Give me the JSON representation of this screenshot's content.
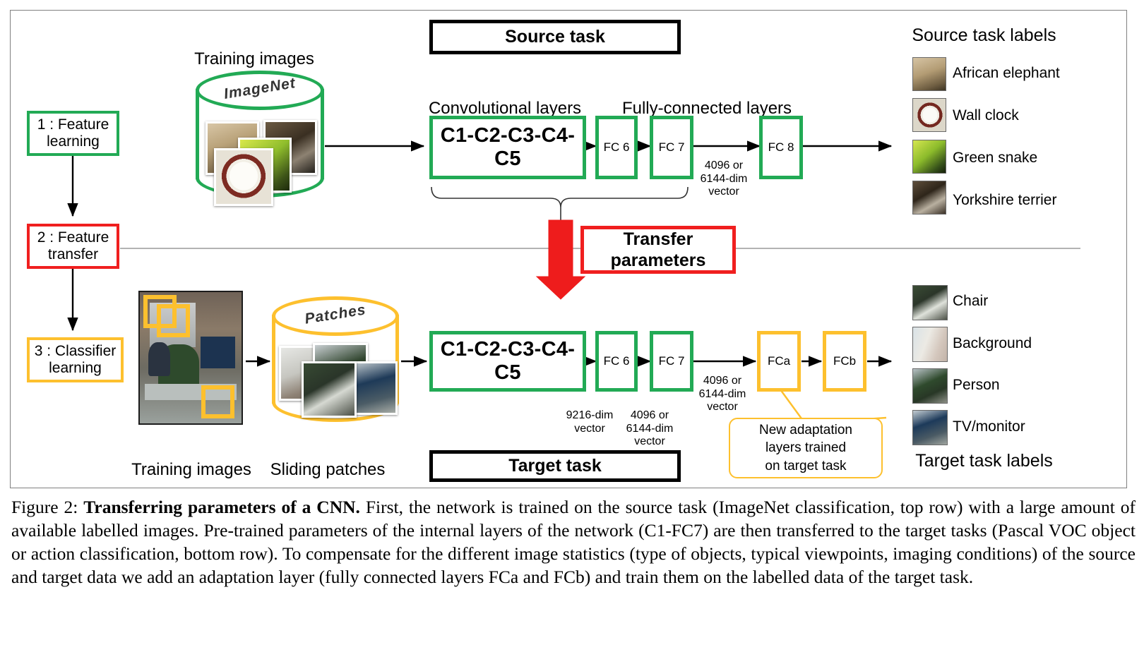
{
  "figure": {
    "banners": {
      "source_task": "Source task",
      "target_task": "Target task",
      "transfer_parameters": "Transfer\nparameters"
    },
    "stages": [
      {
        "label": "1 : Feature\nlearning",
        "color": "#22aa55"
      },
      {
        "label": "2 : Feature\ntransfer",
        "color": "#f01f1f"
      },
      {
        "label": "3 : Classifier\nlearning",
        "color": "#fdc02e"
      }
    ],
    "source_row": {
      "training_images_label": "Training images",
      "database_name": "ImageNet",
      "group_labels": {
        "conv": "Convolutional layers",
        "fc": "Fully-connected layers"
      },
      "layers": [
        {
          "name": "C1-C2-C3-C4-C5",
          "color": "#22aa55"
        },
        {
          "name": "FC 6",
          "color": "#22aa55"
        },
        {
          "name": "FC 7",
          "color": "#22aa55"
        },
        {
          "name": "FC 8",
          "color": "#22aa55"
        }
      ],
      "vector_label": "4096 or\n6144-dim\nvector"
    },
    "target_row": {
      "training_images_label": "Training images",
      "sliding_patches_label": "Sliding patches",
      "database_name": "Patches",
      "layers": [
        {
          "name": "C1-C2-C3-C4-C5",
          "color": "#22aa55"
        },
        {
          "name": "FC 6",
          "color": "#22aa55"
        },
        {
          "name": "FC 7",
          "color": "#22aa55"
        },
        {
          "name": "FCa",
          "color": "#fdc02e"
        },
        {
          "name": "FCb",
          "color": "#fdc02e"
        }
      ],
      "vector_labels": {
        "after_c5": "9216-dim\nvector",
        "after_fc6": "4096 or\n6144-dim\nvector",
        "after_fc7": "4096 or\n6144-dim\nvector"
      },
      "callout": "New adaptation\nlayers trained\non target task"
    },
    "source_panel": {
      "title": "Source task labels",
      "items": [
        {
          "label": "African elephant",
          "thumb": "african-elephant-thumb"
        },
        {
          "label": "Wall clock",
          "thumb": "wall-clock-thumb"
        },
        {
          "label": "Green snake",
          "thumb": "green-snake-thumb"
        },
        {
          "label": "Yorkshire terrier",
          "thumb": "yorkshire-terrier-thumb"
        }
      ]
    },
    "target_panel": {
      "title": "Target task labels",
      "items": [
        {
          "label": "Chair",
          "thumb": "chair-thumb"
        },
        {
          "label": "Background",
          "thumb": "background-thumb"
        },
        {
          "label": "Person",
          "thumb": "person-thumb"
        },
        {
          "label": "TV/monitor",
          "thumb": "tv-monitor-thumb"
        }
      ]
    },
    "colors": {
      "green": "#22aa55",
      "orange": "#fdc02e",
      "red": "#f01f1f",
      "black": "#000000",
      "frame": "#808080"
    }
  },
  "caption": {
    "figure_number": "Figure 2:",
    "title": "Transferring parameters of a CNN.",
    "body": "First, the network is trained on the source task (ImageNet classification, top row) with a large amount of available labelled images. Pre-trained parameters of the internal layers of the network (C1-FC7) are then transferred to the target tasks (Pascal VOC object or action classification, bottom row). To compensate for the different image statistics (type of objects, typical viewpoints, imaging conditions) of the source and target data we add an adaptation layer (fully connected layers FCa and FCb) and train them on the labelled data of the target task."
  }
}
